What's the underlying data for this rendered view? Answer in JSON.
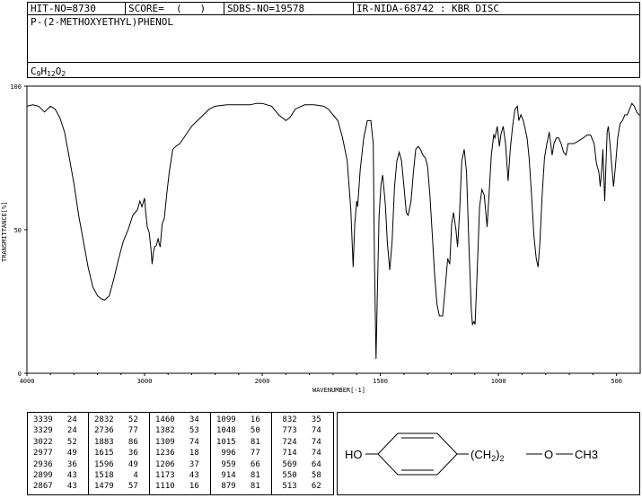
{
  "header": {
    "hit_no": "HIT-NO=8730",
    "score": "SCORE=  (   )",
    "sdbs_no": "SDBS-NO=19578",
    "ir_nida": "IR-NIDA-68742 : KBR DISC"
  },
  "compound": {
    "name": "P-(2-METHOXYETHYL)PHENOL",
    "formula": {
      "C": "9",
      "H": "12",
      "O": "2"
    }
  },
  "structure": {
    "ho": "HO",
    "chain_open": "(CH",
    "chain_sub": "2",
    "chain_close": ")",
    "chain_n": "2",
    "o": "O",
    "ch3": "CH3"
  },
  "peak_table": [
    [
      [
        3339,
        24
      ],
      [
        3329,
        24
      ],
      [
        3022,
        52
      ],
      [
        2977,
        49
      ],
      [
        2936,
        36
      ],
      [
        2899,
        43
      ],
      [
        2867,
        43
      ]
    ],
    [
      [
        2832,
        52
      ],
      [
        2736,
        77
      ],
      [
        1883,
        86
      ],
      [
        1615,
        36
      ],
      [
        1596,
        49
      ],
      [
        1518,
        4
      ],
      [
        1479,
        57
      ]
    ],
    [
      [
        1460,
        34
      ],
      [
        1382,
        53
      ],
      [
        1309,
        74
      ],
      [
        1236,
        18
      ],
      [
        1206,
        37
      ],
      [
        1173,
        43
      ],
      [
        1110,
        16
      ]
    ],
    [
      [
        1099,
        16
      ],
      [
        1048,
        50
      ],
      [
        1015,
        81
      ],
      [
        996,
        77
      ],
      [
        959,
        66
      ],
      [
        914,
        81
      ],
      [
        879,
        81
      ]
    ],
    [
      [
        832,
        35
      ],
      [
        773,
        74
      ],
      [
        724,
        74
      ],
      [
        714,
        74
      ],
      [
        569,
        64
      ],
      [
        550,
        58
      ],
      [
        513,
        62
      ]
    ]
  ],
  "chart_data": {
    "type": "line",
    "title": "",
    "xlabel": "WAVENUMBER[-1]",
    "ylabel": "TRANSMITTANCE[%]",
    "xlim": [
      4000,
      400
    ],
    "ylim": [
      0,
      100
    ],
    "x_ticks": [
      "4000",
      "3000",
      "2000",
      "1500",
      "1000",
      "500"
    ],
    "y_ticks": [
      "0",
      "50",
      "100"
    ],
    "grid": false,
    "series": [
      {
        "points": [
          [
            4000,
            93
          ],
          [
            3950,
            93.5
          ],
          [
            3900,
            93
          ],
          [
            3850,
            91
          ],
          [
            3800,
            93
          ],
          [
            3760,
            92
          ],
          [
            3720,
            89
          ],
          [
            3680,
            84
          ],
          [
            3640,
            75
          ],
          [
            3600,
            66
          ],
          [
            3560,
            55
          ],
          [
            3520,
            46
          ],
          [
            3480,
            37
          ],
          [
            3440,
            30
          ],
          [
            3400,
            27
          ],
          [
            3370,
            26
          ],
          [
            3339,
            25.5
          ],
          [
            3300,
            27
          ],
          [
            3260,
            33
          ],
          [
            3220,
            40
          ],
          [
            3180,
            46
          ],
          [
            3140,
            50
          ],
          [
            3100,
            55
          ],
          [
            3060,
            57
          ],
          [
            3040,
            60
          ],
          [
            3022,
            58
          ],
          [
            3000,
            61
          ],
          [
            2990,
            56
          ],
          [
            2977,
            51
          ],
          [
            2960,
            49
          ],
          [
            2945,
            43
          ],
          [
            2936,
            38
          ],
          [
            2925,
            42
          ],
          [
            2915,
            44
          ],
          [
            2899,
            44.5
          ],
          [
            2885,
            47
          ],
          [
            2875,
            45
          ],
          [
            2867,
            44
          ],
          [
            2850,
            52
          ],
          [
            2832,
            54
          ],
          [
            2810,
            63
          ],
          [
            2790,
            70
          ],
          [
            2760,
            78
          ],
          [
            2736,
            79
          ],
          [
            2700,
            80
          ],
          [
            2650,
            83
          ],
          [
            2600,
            86
          ],
          [
            2550,
            88
          ],
          [
            2500,
            90
          ],
          [
            2450,
            92
          ],
          [
            2400,
            93
          ],
          [
            2300,
            93.5
          ],
          [
            2200,
            93.5
          ],
          [
            2100,
            93.5
          ],
          [
            2050,
            94
          ],
          [
            2000,
            94
          ],
          [
            1960,
            93
          ],
          [
            1930,
            90
          ],
          [
            1900,
            88
          ],
          [
            1883,
            89
          ],
          [
            1860,
            92
          ],
          [
            1820,
            93.5
          ],
          [
            1780,
            93.5
          ],
          [
            1740,
            93
          ],
          [
            1720,
            92
          ],
          [
            1700,
            90
          ],
          [
            1680,
            88
          ],
          [
            1660,
            82
          ],
          [
            1640,
            74
          ],
          [
            1625,
            57
          ],
          [
            1615,
            37
          ],
          [
            1608,
            52
          ],
          [
            1600,
            60
          ],
          [
            1596,
            58
          ],
          [
            1585,
            71
          ],
          [
            1570,
            82
          ],
          [
            1555,
            88
          ],
          [
            1540,
            88
          ],
          [
            1530,
            80
          ],
          [
            1525,
            40
          ],
          [
            1518,
            5
          ],
          [
            1512,
            30
          ],
          [
            1505,
            55
          ],
          [
            1497,
            66
          ],
          [
            1490,
            69
          ],
          [
            1479,
            59
          ],
          [
            1470,
            45
          ],
          [
            1460,
            36
          ],
          [
            1450,
            46
          ],
          [
            1440,
            65
          ],
          [
            1430,
            74
          ],
          [
            1420,
            77
          ],
          [
            1410,
            74
          ],
          [
            1400,
            65
          ],
          [
            1390,
            56
          ],
          [
            1382,
            55
          ],
          [
            1370,
            60
          ],
          [
            1360,
            70
          ],
          [
            1350,
            78
          ],
          [
            1340,
            79
          ],
          [
            1330,
            78
          ],
          [
            1320,
            76
          ],
          [
            1309,
            75
          ],
          [
            1300,
            72
          ],
          [
            1290,
            62
          ],
          [
            1280,
            48
          ],
          [
            1270,
            34
          ],
          [
            1260,
            24
          ],
          [
            1250,
            20
          ],
          [
            1236,
            20
          ],
          [
            1225,
            30
          ],
          [
            1215,
            40
          ],
          [
            1206,
            38
          ],
          [
            1198,
            52
          ],
          [
            1190,
            56
          ],
          [
            1180,
            50
          ],
          [
            1173,
            44
          ],
          [
            1165,
            55
          ],
          [
            1155,
            74
          ],
          [
            1145,
            78
          ],
          [
            1135,
            70
          ],
          [
            1125,
            45
          ],
          [
            1115,
            22
          ],
          [
            1110,
            17
          ],
          [
            1104,
            18
          ],
          [
            1099,
            17
          ],
          [
            1090,
            35
          ],
          [
            1080,
            58
          ],
          [
            1070,
            64
          ],
          [
            1060,
            62
          ],
          [
            1048,
            51
          ],
          [
            1040,
            62
          ],
          [
            1030,
            76
          ],
          [
            1020,
            83
          ],
          [
            1015,
            82
          ],
          [
            1005,
            86
          ],
          [
            996,
            79
          ],
          [
            990,
            83
          ],
          [
            980,
            86
          ],
          [
            970,
            80
          ],
          [
            959,
            67
          ],
          [
            950,
            78
          ],
          [
            940,
            86
          ],
          [
            930,
            92
          ],
          [
            920,
            93
          ],
          [
            914,
            88
          ],
          [
            905,
            90
          ],
          [
            895,
            88
          ],
          [
            879,
            82
          ],
          [
            870,
            75
          ],
          [
            860,
            62
          ],
          [
            850,
            48
          ],
          [
            840,
            40
          ],
          [
            832,
            37
          ],
          [
            825,
            45
          ],
          [
            815,
            62
          ],
          [
            805,
            75
          ],
          [
            795,
            80
          ],
          [
            785,
            84
          ],
          [
            773,
            76
          ],
          [
            765,
            80
          ],
          [
            755,
            82
          ],
          [
            745,
            82
          ],
          [
            735,
            80
          ],
          [
            724,
            77
          ],
          [
            714,
            76
          ],
          [
            705,
            80
          ],
          [
            695,
            80
          ],
          [
            680,
            80
          ],
          [
            660,
            81
          ],
          [
            640,
            82
          ],
          [
            625,
            83
          ],
          [
            610,
            83
          ],
          [
            595,
            80
          ],
          [
            585,
            73
          ],
          [
            575,
            70
          ],
          [
            569,
            65
          ],
          [
            562,
            72
          ],
          [
            558,
            78
          ],
          [
            550,
            60
          ],
          [
            545,
            72
          ],
          [
            540,
            84
          ],
          [
            535,
            86
          ],
          [
            528,
            80
          ],
          [
            520,
            72
          ],
          [
            513,
            65
          ],
          [
            505,
            72
          ],
          [
            495,
            82
          ],
          [
            485,
            87
          ],
          [
            475,
            88
          ],
          [
            465,
            90
          ],
          [
            455,
            90
          ],
          [
            445,
            92
          ],
          [
            435,
            94
          ],
          [
            425,
            93
          ],
          [
            415,
            91
          ],
          [
            405,
            90
          ],
          [
            400,
            90
          ]
        ]
      }
    ]
  }
}
